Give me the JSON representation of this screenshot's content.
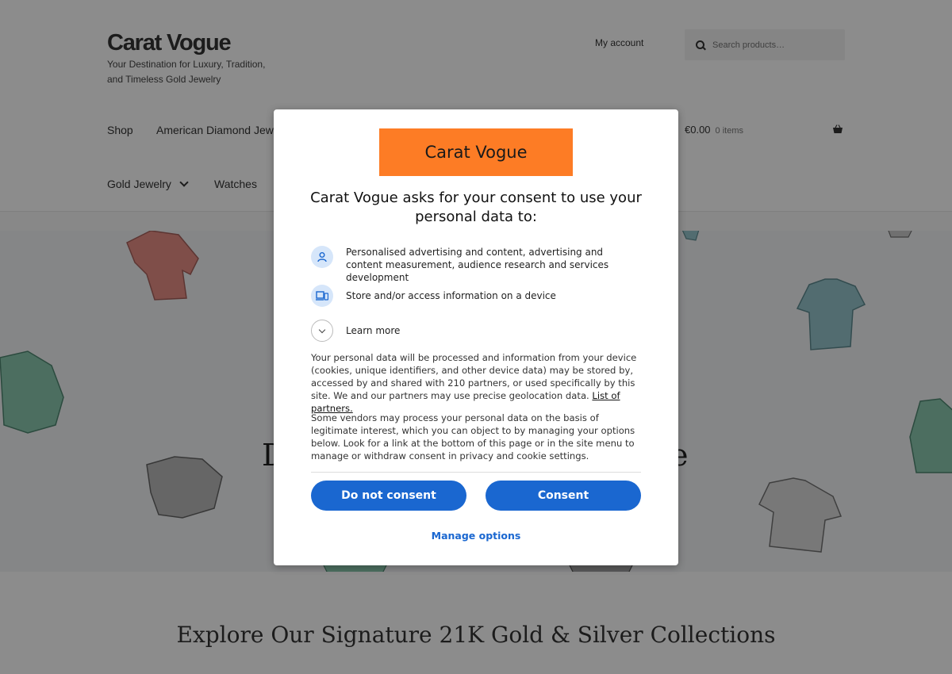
{
  "site": {
    "title": "Carat Vogue",
    "tagline": "Your Destination for Luxury, Tradition, and Timeless Gold Jewelry",
    "my_account": "My account",
    "search_placeholder": "Search products…",
    "nav": [
      "Shop",
      "American Diamond Jew",
      "Gold Jewelry",
      "Watches"
    ],
    "cart_total": "€0.00",
    "cart_count": "0 items",
    "hero_left": "D",
    "hero_right": "e",
    "section_title": "Explore Our Signature 21K Gold & Silver Collections"
  },
  "consent": {
    "logo_text": "Carat Vogue",
    "heading": "Carat Vogue asks for your consent to use your personal data to:",
    "purposes": [
      {
        "icon": "person-icon",
        "text": "Personalised advertising and content, advertising and content measurement, audience research and services development"
      },
      {
        "icon": "devices-icon",
        "text": "Store and/or access information on a device"
      }
    ],
    "learn_more": "Learn more",
    "paragraph1": "Your personal data will be processed and information from your device (cookies, unique identifiers, and other device data) may be stored by, accessed by and shared with 210 partners, or used specifically by this site. We and our partners may use precise geolocation data.",
    "partners_link": "List of partners.",
    "paragraph2": "Some vendors may process your personal data on the basis of legitimate interest, which you can object to by managing your options below. Look for a link at the bottom of this page or in the site menu to manage or withdraw consent in privacy and cookie settings.",
    "do_not_consent": "Do not consent",
    "consent_button": "Consent",
    "manage_options": "Manage options"
  },
  "colors": {
    "accent": "#1a67d0",
    "logo_bg": "#fd7c25"
  }
}
